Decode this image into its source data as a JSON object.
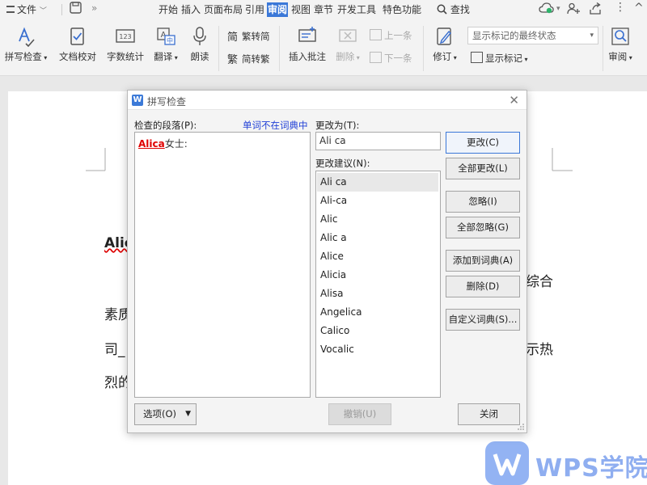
{
  "menubar": {
    "file": "文件",
    "tabs": [
      "开始",
      "插入",
      "页面布局",
      "引用",
      "审阅",
      "视图",
      "章节",
      "开发工具",
      "特色功能"
    ],
    "search": "查找"
  },
  "ribbon": {
    "spell_check": "拼写检查",
    "doc_proof": "文档校对",
    "word_count": "字数统计",
    "translate": "翻译",
    "read_aloud": "朗读",
    "trad_to_simp": "繁转简",
    "simp_to_trad": "简转繁",
    "insert_comment": "插入批注",
    "delete": "删除",
    "prev": "上一条",
    "next": "下一条",
    "revise": "修订",
    "display_mode": "显示标记的最终状态",
    "show_markup": "显示标记",
    "review": "审阅"
  },
  "document": {
    "line1": "Alic",
    "line1_right": "综合",
    "line2": "素质",
    "line3": "司_",
    "line3_right": "示热",
    "line4": "烈的"
  },
  "watermark": "WPS学院",
  "dialog": {
    "title": "拼写检查",
    "para_label": "检查的段落(P):",
    "not_in_dict": "单词不在词典中",
    "paragraph_bad_word": "Alica",
    "paragraph_rest": "女士:",
    "change_to_label": "更改为(T):",
    "change_to_value": "Ali ca",
    "suggestions_label": "更改建议(N):",
    "suggestions": [
      "Ali ca",
      "Ali-ca",
      "Alic",
      "Alic a",
      "Alice",
      "Alicia",
      "Alisa",
      "Angelica",
      "Calico",
      "Vocalic"
    ],
    "buttons": {
      "change": "更改(C)",
      "change_all": "全部更改(L)",
      "ignore": "忽略(I)",
      "ignore_all": "全部忽略(G)",
      "add_to_dict": "添加到词典(A)",
      "delete": "删除(D)",
      "custom_dict": "自定义词典(S)...",
      "options": "选项(O)",
      "undo": "撤销(U)",
      "close": "关闭"
    }
  }
}
